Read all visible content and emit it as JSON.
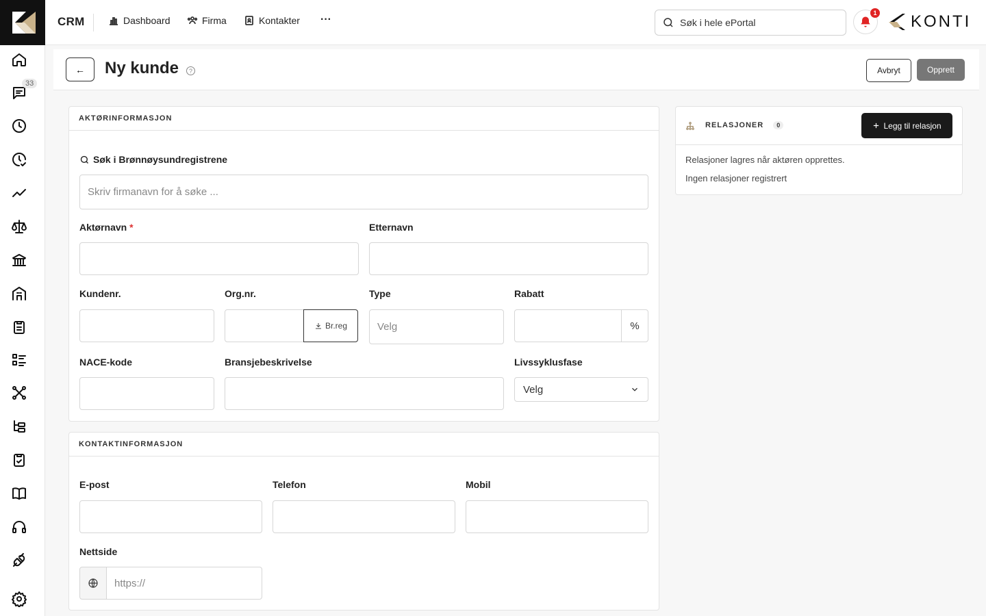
{
  "topbar": {
    "app_title": "CRM",
    "nav": [
      {
        "label": "Dashboard",
        "icon": "bar-chart-icon"
      },
      {
        "label": "Firma",
        "icon": "users-icon"
      },
      {
        "label": "Kontakter",
        "icon": "contact-book-icon"
      }
    ],
    "more_label": "···",
    "search_placeholder": "Søk i hele ePortal",
    "notification_count": "1",
    "brand": "KONTI"
  },
  "sidebar": {
    "message_count": "33",
    "items": [
      "home-icon",
      "messages-icon",
      "clock-icon",
      "clock-check-icon",
      "trend-icon",
      "scale-icon",
      "bank-icon",
      "building-icon",
      "clipboard-icon",
      "list-icon",
      "network-icon",
      "tree-icon",
      "clipboard-check-icon",
      "book-icon",
      "headset-icon",
      "plug-icon",
      "settings-icon"
    ]
  },
  "page": {
    "back_label": "←",
    "title": "Ny kunde",
    "help": "?",
    "cancel_label": "Avbryt",
    "create_label": "Opprett"
  },
  "actor_card": {
    "heading": "AKTØRINFORMASJON",
    "brreg_search_label": "Søk i Brønnøysundregistrene",
    "brreg_search_placeholder": "Skriv firmanavn for å søke ...",
    "actor_name_label": "Aktørnavn",
    "required_mark": "*",
    "last_name_label": "Etternavn",
    "customer_no_label": "Kundenr.",
    "org_no_label": "Org.nr.",
    "brreg_button_label": "Br.reg",
    "type_label": "Type",
    "type_placeholder": "Velg",
    "discount_label": "Rabatt",
    "discount_unit": "%",
    "nace_label": "NACE-kode",
    "industry_label": "Bransjebeskrivelse",
    "lifecycle_label": "Livssyklusfase",
    "lifecycle_value": "Velg"
  },
  "contact_card": {
    "heading": "KONTAKTINFORMASJON",
    "email_label": "E-post",
    "phone_label": "Telefon",
    "mobile_label": "Mobil",
    "website_label": "Nettside",
    "website_placeholder": "https://"
  },
  "relations_card": {
    "heading": "RELASJONER",
    "count": "0",
    "add_button_label": "Legg til relasjon",
    "note": "Relasjoner lagres når aktøren opprettes.",
    "empty_text": "Ingen relasjoner registrert"
  }
}
